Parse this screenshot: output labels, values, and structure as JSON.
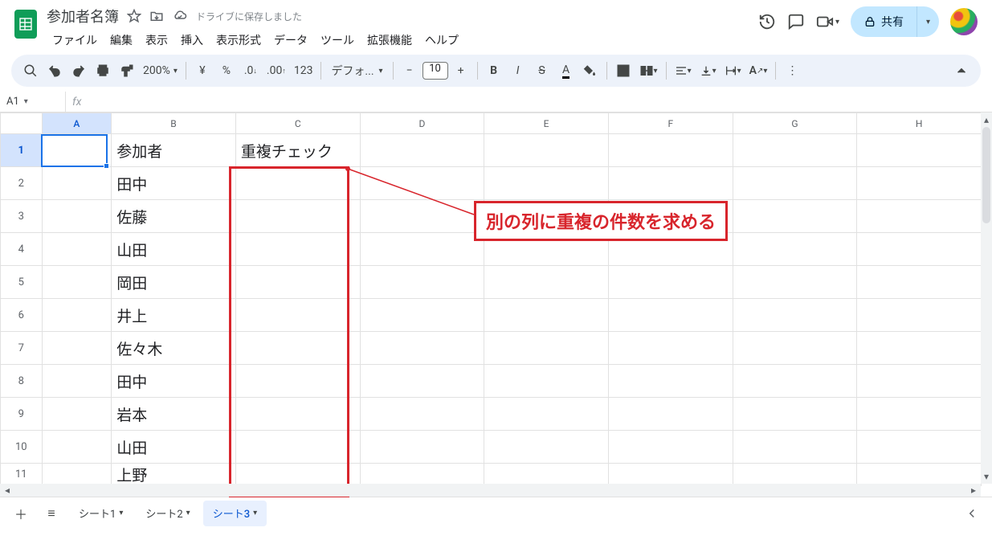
{
  "doc": {
    "title": "参加者名簿",
    "save_status": "ドライブに保存しました"
  },
  "menus": [
    "ファイル",
    "編集",
    "表示",
    "挿入",
    "表示形式",
    "データ",
    "ツール",
    "拡張機能",
    "ヘルプ"
  ],
  "share": {
    "label": "共有"
  },
  "toolbar": {
    "zoom": "200%",
    "font": "デフォ...",
    "font_size": "10"
  },
  "namebox": {
    "ref": "A1"
  },
  "columns": [
    "A",
    "B",
    "C",
    "D",
    "E",
    "F",
    "G",
    "H"
  ],
  "rows": [
    1,
    2,
    3,
    4,
    5,
    6,
    7,
    8,
    9,
    10,
    11
  ],
  "cells": {
    "B1": "参加者",
    "C1": "重複チェック",
    "B2": "田中",
    "B3": "佐藤",
    "B4": "山田",
    "B5": "岡田",
    "B6": "井上",
    "B7": "佐々木",
    "B8": "田中",
    "B9": "岩本",
    "B10": "山田",
    "B11": "上野"
  },
  "annotation": {
    "callout": "別の列に重複の件数を求める"
  },
  "tabs": [
    {
      "name": "シート1",
      "active": false
    },
    {
      "name": "シート2",
      "active": false
    },
    {
      "name": "シート3",
      "active": true
    }
  ]
}
